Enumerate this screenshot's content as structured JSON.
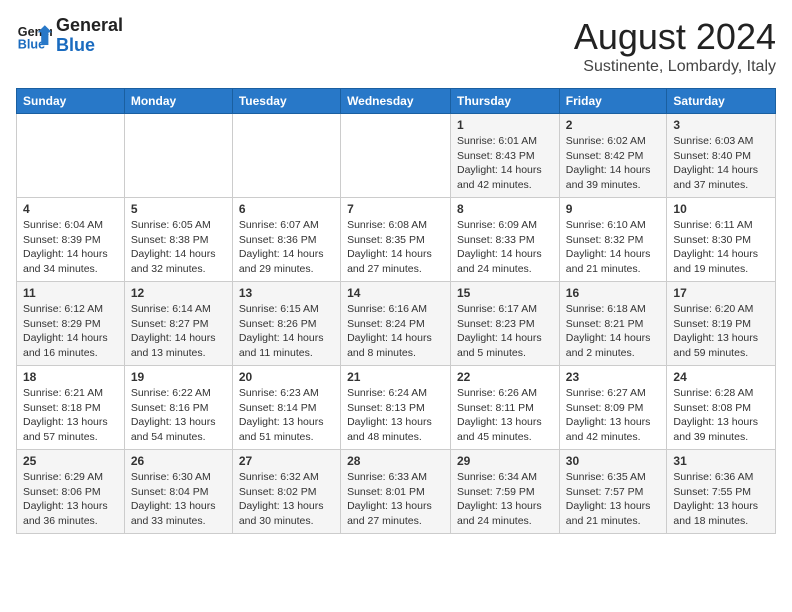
{
  "header": {
    "logo_general": "General",
    "logo_blue": "Blue",
    "month": "August 2024",
    "location": "Sustinente, Lombardy, Italy"
  },
  "weekdays": [
    "Sunday",
    "Monday",
    "Tuesday",
    "Wednesday",
    "Thursday",
    "Friday",
    "Saturday"
  ],
  "weeks": [
    [
      {
        "day": "",
        "info": ""
      },
      {
        "day": "",
        "info": ""
      },
      {
        "day": "",
        "info": ""
      },
      {
        "day": "",
        "info": ""
      },
      {
        "day": "1",
        "info": "Sunrise: 6:01 AM\nSunset: 8:43 PM\nDaylight: 14 hours\nand 42 minutes."
      },
      {
        "day": "2",
        "info": "Sunrise: 6:02 AM\nSunset: 8:42 PM\nDaylight: 14 hours\nand 39 minutes."
      },
      {
        "day": "3",
        "info": "Sunrise: 6:03 AM\nSunset: 8:40 PM\nDaylight: 14 hours\nand 37 minutes."
      }
    ],
    [
      {
        "day": "4",
        "info": "Sunrise: 6:04 AM\nSunset: 8:39 PM\nDaylight: 14 hours\nand 34 minutes."
      },
      {
        "day": "5",
        "info": "Sunrise: 6:05 AM\nSunset: 8:38 PM\nDaylight: 14 hours\nand 32 minutes."
      },
      {
        "day": "6",
        "info": "Sunrise: 6:07 AM\nSunset: 8:36 PM\nDaylight: 14 hours\nand 29 minutes."
      },
      {
        "day": "7",
        "info": "Sunrise: 6:08 AM\nSunset: 8:35 PM\nDaylight: 14 hours\nand 27 minutes."
      },
      {
        "day": "8",
        "info": "Sunrise: 6:09 AM\nSunset: 8:33 PM\nDaylight: 14 hours\nand 24 minutes."
      },
      {
        "day": "9",
        "info": "Sunrise: 6:10 AM\nSunset: 8:32 PM\nDaylight: 14 hours\nand 21 minutes."
      },
      {
        "day": "10",
        "info": "Sunrise: 6:11 AM\nSunset: 8:30 PM\nDaylight: 14 hours\nand 19 minutes."
      }
    ],
    [
      {
        "day": "11",
        "info": "Sunrise: 6:12 AM\nSunset: 8:29 PM\nDaylight: 14 hours\nand 16 minutes."
      },
      {
        "day": "12",
        "info": "Sunrise: 6:14 AM\nSunset: 8:27 PM\nDaylight: 14 hours\nand 13 minutes."
      },
      {
        "day": "13",
        "info": "Sunrise: 6:15 AM\nSunset: 8:26 PM\nDaylight: 14 hours\nand 11 minutes."
      },
      {
        "day": "14",
        "info": "Sunrise: 6:16 AM\nSunset: 8:24 PM\nDaylight: 14 hours\nand 8 minutes."
      },
      {
        "day": "15",
        "info": "Sunrise: 6:17 AM\nSunset: 8:23 PM\nDaylight: 14 hours\nand 5 minutes."
      },
      {
        "day": "16",
        "info": "Sunrise: 6:18 AM\nSunset: 8:21 PM\nDaylight: 14 hours\nand 2 minutes."
      },
      {
        "day": "17",
        "info": "Sunrise: 6:20 AM\nSunset: 8:19 PM\nDaylight: 13 hours\nand 59 minutes."
      }
    ],
    [
      {
        "day": "18",
        "info": "Sunrise: 6:21 AM\nSunset: 8:18 PM\nDaylight: 13 hours\nand 57 minutes."
      },
      {
        "day": "19",
        "info": "Sunrise: 6:22 AM\nSunset: 8:16 PM\nDaylight: 13 hours\nand 54 minutes."
      },
      {
        "day": "20",
        "info": "Sunrise: 6:23 AM\nSunset: 8:14 PM\nDaylight: 13 hours\nand 51 minutes."
      },
      {
        "day": "21",
        "info": "Sunrise: 6:24 AM\nSunset: 8:13 PM\nDaylight: 13 hours\nand 48 minutes."
      },
      {
        "day": "22",
        "info": "Sunrise: 6:26 AM\nSunset: 8:11 PM\nDaylight: 13 hours\nand 45 minutes."
      },
      {
        "day": "23",
        "info": "Sunrise: 6:27 AM\nSunset: 8:09 PM\nDaylight: 13 hours\nand 42 minutes."
      },
      {
        "day": "24",
        "info": "Sunrise: 6:28 AM\nSunset: 8:08 PM\nDaylight: 13 hours\nand 39 minutes."
      }
    ],
    [
      {
        "day": "25",
        "info": "Sunrise: 6:29 AM\nSunset: 8:06 PM\nDaylight: 13 hours\nand 36 minutes."
      },
      {
        "day": "26",
        "info": "Sunrise: 6:30 AM\nSunset: 8:04 PM\nDaylight: 13 hours\nand 33 minutes."
      },
      {
        "day": "27",
        "info": "Sunrise: 6:32 AM\nSunset: 8:02 PM\nDaylight: 13 hours\nand 30 minutes."
      },
      {
        "day": "28",
        "info": "Sunrise: 6:33 AM\nSunset: 8:01 PM\nDaylight: 13 hours\nand 27 minutes."
      },
      {
        "day": "29",
        "info": "Sunrise: 6:34 AM\nSunset: 7:59 PM\nDaylight: 13 hours\nand 24 minutes."
      },
      {
        "day": "30",
        "info": "Sunrise: 6:35 AM\nSunset: 7:57 PM\nDaylight: 13 hours\nand 21 minutes."
      },
      {
        "day": "31",
        "info": "Sunrise: 6:36 AM\nSunset: 7:55 PM\nDaylight: 13 hours\nand 18 minutes."
      }
    ]
  ]
}
